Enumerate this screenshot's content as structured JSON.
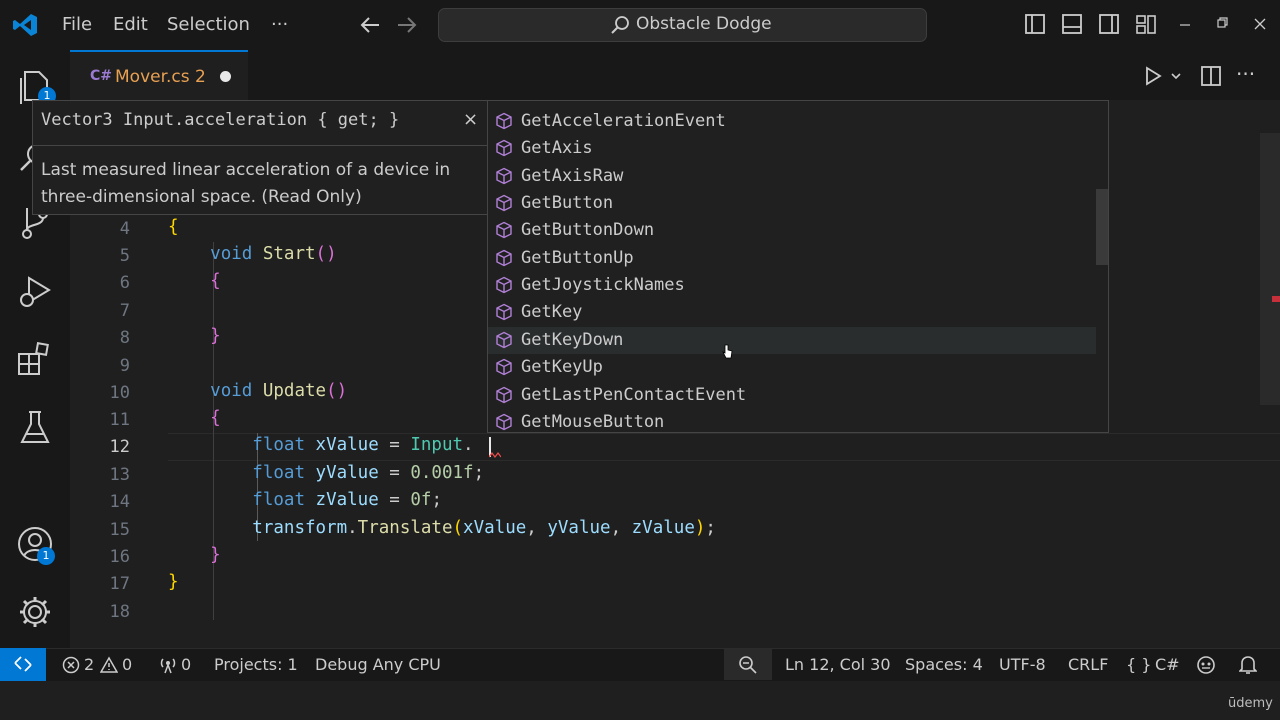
{
  "titlebar": {
    "menu": [
      "File",
      "Edit",
      "Selection",
      "···"
    ],
    "search_text": "Obstacle Dodge"
  },
  "activity_bar": {
    "explorer_badge": "1",
    "accounts_badge": "1"
  },
  "tab": {
    "file_icon": "C#",
    "label": "Mover.cs 2",
    "modified": true
  },
  "editor": {
    "line_numbers": [
      "4",
      "5",
      "6",
      "7",
      "8",
      "9",
      "10",
      "11",
      "12",
      "13",
      "14",
      "15",
      "16",
      "17",
      "18"
    ],
    "active_line": "12",
    "code": {
      "l4": "{",
      "l5_kw": "void",
      "l5_fn": "Start",
      "l5_paren": "()",
      "l6": "{",
      "l8": "}",
      "l10_kw": "void",
      "l10_fn": "Update",
      "l10_paren": "()",
      "l11": "{",
      "l12_kw": "float",
      "l12_var": "xValue",
      "l12_eq": " = ",
      "l12_cls": "Input",
      "l12_dot": ".",
      "l13_kw": "float",
      "l13_var": "yValue",
      "l13_eq": " = ",
      "l13_num": "0.001f",
      "l13_end": ";",
      "l14_kw": "float",
      "l14_var": "zValue",
      "l14_eq": " = ",
      "l14_num": "0f",
      "l14_end": ";",
      "l15_obj": "transform",
      "l15_dot": ".",
      "l15_fn": "Translate",
      "l15_open": "(",
      "l15_a": "xValue",
      "l15_c1": ", ",
      "l15_b": "yValue",
      "l15_c2": ", ",
      "l15_c": "zValue",
      "l15_close": ")",
      "l15_end": ";",
      "l16": "}",
      "l17": "}"
    }
  },
  "hover": {
    "signature": "Vector3 Input.acceleration { get; }",
    "close": "×",
    "description": "Last measured linear acceleration of a device in three-dimensional space. (Read Only)"
  },
  "suggestions": {
    "items": [
      "GetAccelerationEvent",
      "GetAxis",
      "GetAxisRaw",
      "GetButton",
      "GetButtonDown",
      "GetButtonUp",
      "GetJoystickNames",
      "GetKey",
      "GetKeyDown",
      "GetKeyUp",
      "GetLastPenContactEvent",
      "GetMouseButton"
    ],
    "selected_index": 8,
    "icon": "method-cube-icon"
  },
  "statusbar": {
    "errors": "2",
    "warnings": "0",
    "ports": "0",
    "projects": "Projects: 1",
    "config": "Debug Any CPU",
    "position": "Ln 12, Col 30",
    "spaces": "Spaces: 4",
    "encoding": "UTF-8",
    "eol": "CRLF",
    "language": "C#"
  },
  "watermark": "ūdemy",
  "colors": {
    "accent": "#0078d4",
    "keyword": "#569cd6",
    "function": "#dcdcaa",
    "variable": "#9cdcfe",
    "number": "#b5cea8",
    "class": "#4ec9b0",
    "method_icon": "#b180d7"
  }
}
